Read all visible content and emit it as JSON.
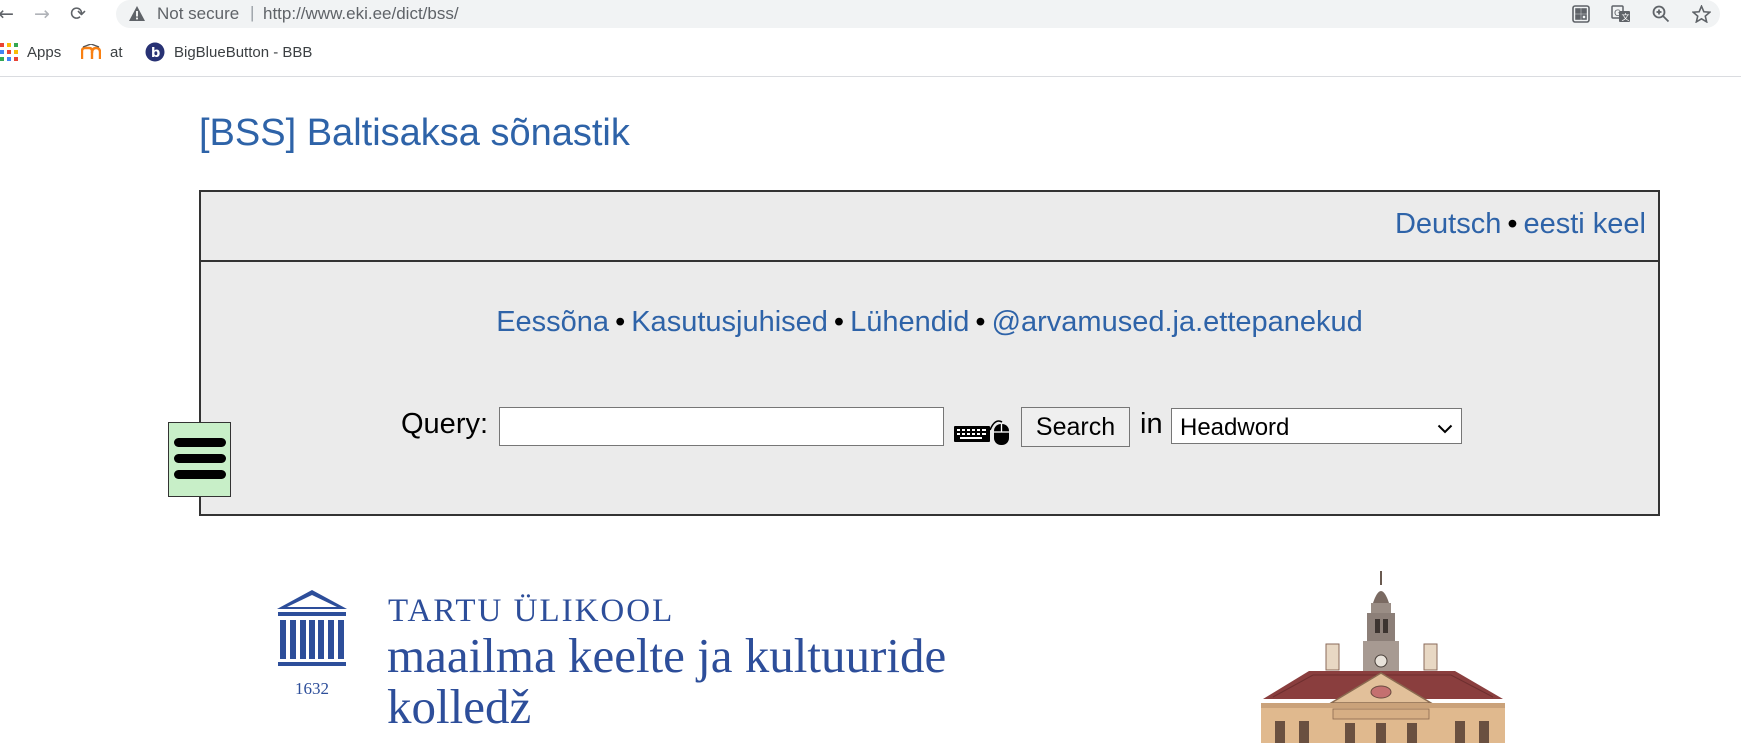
{
  "browser": {
    "security_label": "Not secure",
    "separator": "|",
    "url": "http://www.eki.ee/dict/bss/"
  },
  "bookmarks": [
    {
      "label": "Apps",
      "icon": "apps-grid-icon"
    },
    {
      "label": "at",
      "icon": "moodle-icon"
    },
    {
      "label": "BigBlueButton - BBB",
      "icon": "bigbluebutton-icon"
    }
  ],
  "page": {
    "title": "[BSS] Baltisaksa sõnastik"
  },
  "languages": {
    "items": [
      "Deutsch",
      "eesti keel"
    ],
    "separator": "•"
  },
  "info_links": {
    "items": [
      "Eessõna",
      "Kasutusjuhised",
      "Lühendid",
      "@arvamused.ja.ettepanekud"
    ],
    "separator": "•"
  },
  "search": {
    "query_label": "Query:",
    "query_value": "",
    "button_label": "Search",
    "in_label": "in",
    "field_selected": "Headword"
  },
  "footer": {
    "university_name": "TARTU ÜLIKOOL",
    "college_line1": "maailma keelte ja kultuuride",
    "college_line2": "kolledž",
    "logo_year": "1632"
  },
  "colors": {
    "link": "#2e63a8",
    "panel_bg": "#ebebeb",
    "menu_bg": "#c8efc8",
    "university_blue": "#2d4e9a"
  }
}
